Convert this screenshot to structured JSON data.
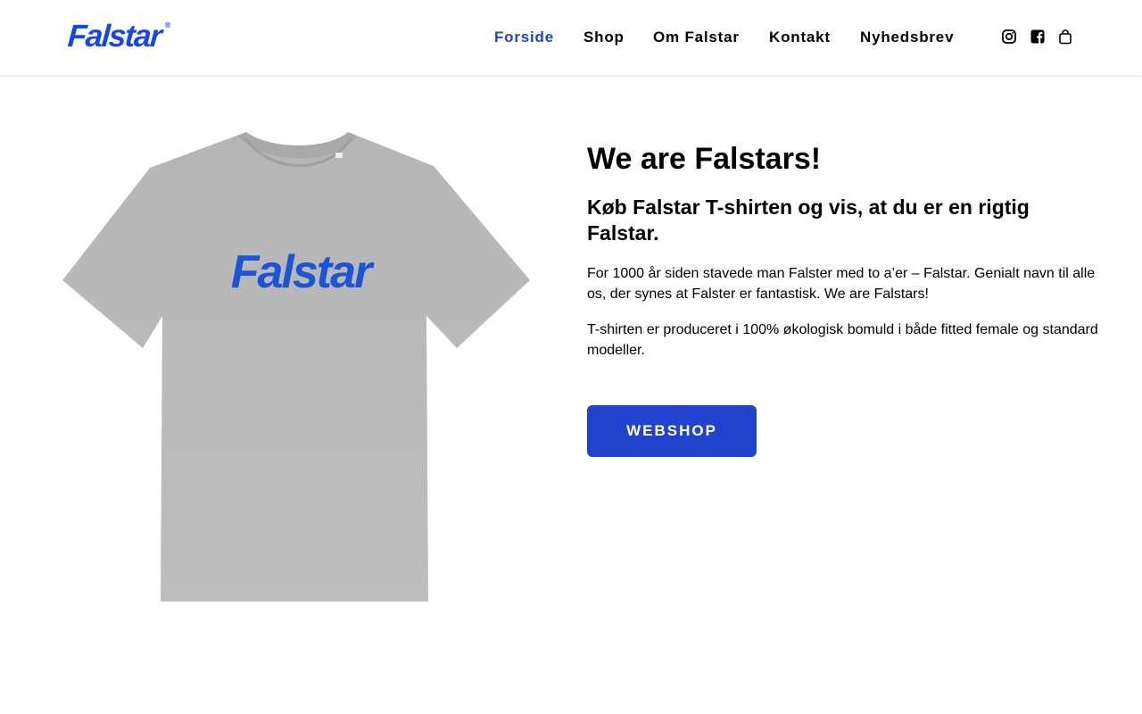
{
  "brand": {
    "logo_text": "Falstar",
    "logo_mark": "®",
    "color": "#1447e6"
  },
  "nav": {
    "items": [
      {
        "label": "Forside",
        "active": true
      },
      {
        "label": "Shop",
        "active": false
      },
      {
        "label": "Om Falstar",
        "active": false
      },
      {
        "label": "Kontakt",
        "active": false
      },
      {
        "label": "Nyhedsbrev",
        "active": false
      }
    ],
    "active_color": "#2142c8"
  },
  "icons": [
    "instagram-icon",
    "facebook-icon",
    "shopping-bag-icon"
  ],
  "hero": {
    "image_print_text": "Falstar",
    "shirt_color": "#b8b8b8",
    "print_color": "#1b55d6",
    "title": "We are Falstars!",
    "subtitle": "Køb Falstar T-shirten og vis, at du er en rigtig Falstar.",
    "paragraphs": [
      "For 1000 år siden stavede man Falster med to a’er – Falstar. Genialt navn til alle os, der synes at Falster er fantastisk. We are Falstars!",
      "T-shirten er produceret i 100% økologisk bomuld i både fitted female og standard modeller."
    ],
    "button_label": "WEBSHOP",
    "button_color": "#2142cd"
  }
}
